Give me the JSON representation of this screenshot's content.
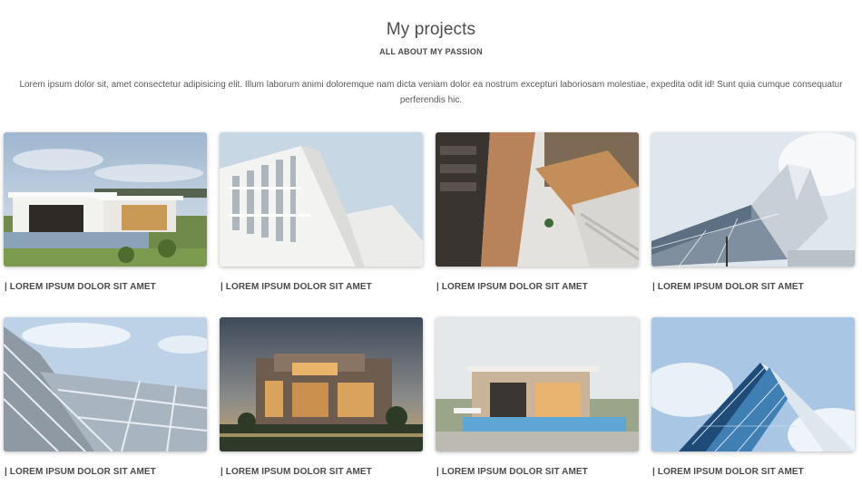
{
  "section": {
    "title": "My projects",
    "subtitle": "ALL ABOUT MY PASSION",
    "intro": "Lorem ipsum dolor sit, amet consectetur adipisicing elit. Illum laborum animi doloremque nam dicta veniam dolor ea nostrum excepturi laboriosam molestiae, expedita odit id! Sunt quia cumque consequatur perferendis hic."
  },
  "projects": [
    {
      "caption": "| LOREM IPSUM DOLOR SIT AMET",
      "image": "modern-villa-with-pool"
    },
    {
      "caption": "| LOREM IPSUM DOLOR SIT AMET",
      "image": "white-facade-building"
    },
    {
      "caption": "| LOREM IPSUM DOLOR SIT AMET",
      "image": "spiral-staircase-interior"
    },
    {
      "caption": "| LOREM IPSUM DOLOR SIT AMET",
      "image": "angular-glass-museum"
    },
    {
      "caption": "| LOREM IPSUM DOLOR SIT AMET",
      "image": "glass-roof-structure"
    },
    {
      "caption": "| LOREM IPSUM DOLOR SIT AMET",
      "image": "lit-building-at-dusk"
    },
    {
      "caption": "| LOREM IPSUM DOLOR SIT AMET",
      "image": "house-with-pool-render"
    },
    {
      "caption": "| LOREM IPSUM DOLOR SIT AMET",
      "image": "glass-skyscraper-upview"
    }
  ]
}
